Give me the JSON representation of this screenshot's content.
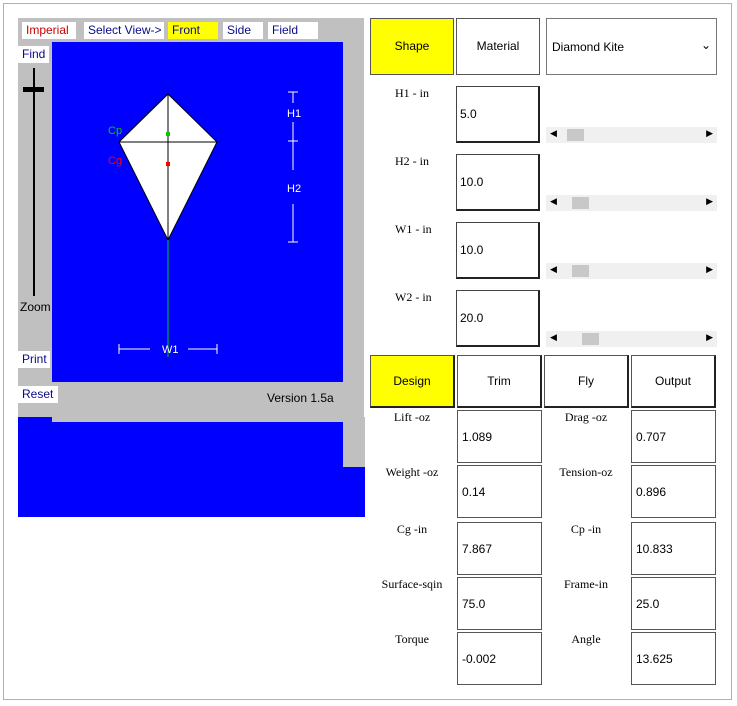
{
  "view_tabs": {
    "units": "Imperial",
    "select_view": "Select View->",
    "front": "Front",
    "side": "Side",
    "field": "Field"
  },
  "left_controls": {
    "find": "Find",
    "zoom": "Zoom",
    "print": "Print",
    "reset": "Reset"
  },
  "version": "Version 1.5a",
  "kite_labels": {
    "cp": "Cp",
    "cg": "Cg",
    "h1": "H1",
    "h2": "H2",
    "w1": "W1"
  },
  "top_tabs": {
    "shape": "Shape",
    "material": "Material"
  },
  "shape_select": {
    "value": "Diamond Kite"
  },
  "params": [
    {
      "label": "H1 - in",
      "value": "5.0",
      "slider": 0.12
    },
    {
      "label": "H2 - in",
      "value": "10.0",
      "slider": 0.15
    },
    {
      "label": "W1 - in",
      "value": "10.0",
      "slider": 0.12
    },
    {
      "label": "W2 - in",
      "value": "20.0",
      "slider": 0.2
    }
  ],
  "bottom_tabs": {
    "design": "Design",
    "trim": "Trim",
    "fly": "Fly",
    "output": "Output"
  },
  "outputs": [
    {
      "left_label": "Lift -oz",
      "left_value": "1.089",
      "right_label": "Drag -oz",
      "right_value": "0.707"
    },
    {
      "left_label": "Weight -oz",
      "left_value": "0.14",
      "right_label": "Tension-oz",
      "right_value": "0.896"
    },
    {
      "left_label": "Cg -in",
      "left_value": "7.867",
      "right_label": "Cp -in",
      "right_value": "10.833"
    },
    {
      "left_label": "Surface-sqin",
      "left_value": "75.0",
      "right_label": "Frame-in",
      "right_value": "25.0"
    },
    {
      "left_label": "Torque",
      "left_value": "-0.002",
      "right_label": "Angle",
      "right_value": "13.625"
    }
  ],
  "colors": {
    "view_bg": "#0000ff",
    "selected": "#ffff00",
    "cp_marker": "#00cc00",
    "cg_marker": "#ff0000"
  }
}
